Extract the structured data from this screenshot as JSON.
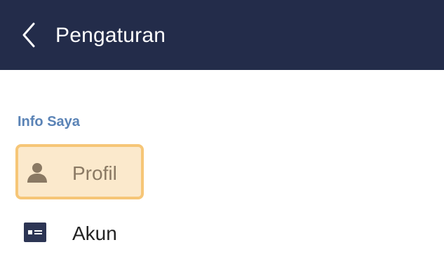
{
  "header": {
    "back_icon": "chevron-left-icon",
    "title": "Pengaturan",
    "background_color": "#232c4a"
  },
  "section": {
    "label": "Info Saya",
    "label_color": "#5a83b6"
  },
  "menu": {
    "items": [
      {
        "label": "Profil",
        "icon": "person-icon",
        "highlighted": true,
        "highlight_color": "#fbe9cc"
      },
      {
        "label": "Akun",
        "icon": "id-card-icon",
        "highlighted": false
      }
    ]
  }
}
